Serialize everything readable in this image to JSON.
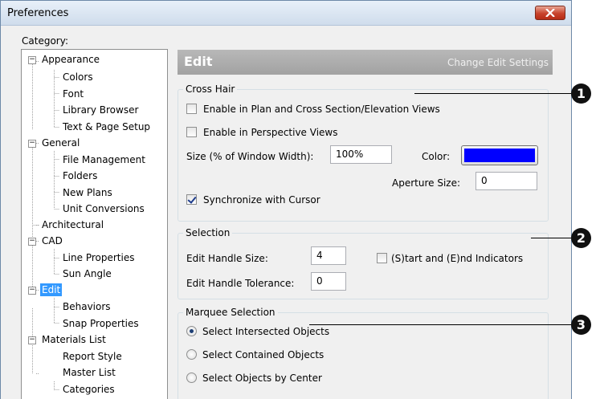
{
  "window": {
    "title": "Preferences"
  },
  "category": {
    "label": "Category:",
    "tree": [
      {
        "label": "Appearance",
        "expander": "−"
      },
      {
        "label": "Colors"
      },
      {
        "label": "Font"
      },
      {
        "label": "Library Browser"
      },
      {
        "label": "Text & Page Setup"
      },
      {
        "label": "General",
        "expander": "−"
      },
      {
        "label": "File Management"
      },
      {
        "label": "Folders"
      },
      {
        "label": "New Plans"
      },
      {
        "label": "Unit Conversions"
      },
      {
        "label": "Architectural"
      },
      {
        "label": "CAD",
        "expander": "−"
      },
      {
        "label": "Line Properties"
      },
      {
        "label": "Sun Angle"
      },
      {
        "label": "Edit",
        "expander": "−",
        "selected": true
      },
      {
        "label": "Behaviors"
      },
      {
        "label": "Snap Properties"
      },
      {
        "label": "Materials List",
        "expander": "−"
      },
      {
        "label": "Report Style"
      },
      {
        "label": "Master List"
      },
      {
        "label": "Categories"
      }
    ]
  },
  "header": {
    "title": "Edit",
    "subtitle": "Change Edit Settings"
  },
  "crosshair": {
    "title": "Cross Hair",
    "plan_views_label": "Enable in Plan and Cross Section/Elevation Views",
    "plan_views_checked": false,
    "perspective_label": "Enable in Perspective Views",
    "perspective_checked": false,
    "size_label": "Size (% of Window Width):",
    "size_value": "100%",
    "color_label": "Color:",
    "color_value": "#0000ff",
    "aperture_label": "Aperture Size:",
    "aperture_value": "0",
    "sync_label": "Synchronize with Cursor",
    "sync_checked": true
  },
  "selection": {
    "title": "Selection",
    "handle_size_label": "Edit Handle Size:",
    "handle_size_value": "4",
    "indicators_label": "(S)tart and (E)nd Indicators",
    "indicators_checked": false,
    "tolerance_label": "Edit Handle Tolerance:",
    "tolerance_value": "0"
  },
  "marquee": {
    "title": "Marquee Selection",
    "options": [
      {
        "label": "Select Intersected Objects",
        "selected": true
      },
      {
        "label": "Select Contained Objects",
        "selected": false
      },
      {
        "label": "Select Objects by Center",
        "selected": false
      }
    ]
  },
  "callouts": [
    "1",
    "2",
    "3"
  ]
}
